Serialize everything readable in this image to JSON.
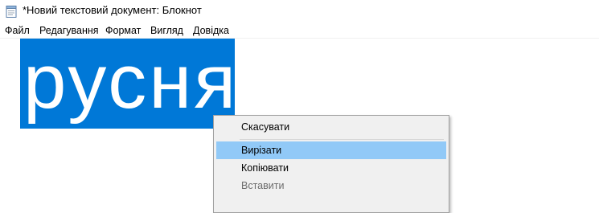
{
  "window": {
    "title": "*Новий текстовий документ: Блокнот",
    "icon": "notepad-icon"
  },
  "menubar": {
    "items": [
      {
        "label": "Файл"
      },
      {
        "label": "Редагування"
      },
      {
        "label": "Формат"
      },
      {
        "label": "Вигляд"
      },
      {
        "label": "Довідка"
      }
    ]
  },
  "editor": {
    "selected_text": "русня",
    "selection_color": "#0078d7"
  },
  "context_menu": {
    "items": [
      {
        "label": "Скасувати",
        "state": "normal"
      },
      {
        "label": "Вирізати",
        "state": "highlighted"
      },
      {
        "label": "Копіювати",
        "state": "normal"
      },
      {
        "label": "Вставити",
        "state": "disabled"
      }
    ],
    "highlight_color": "#91c9f7"
  }
}
